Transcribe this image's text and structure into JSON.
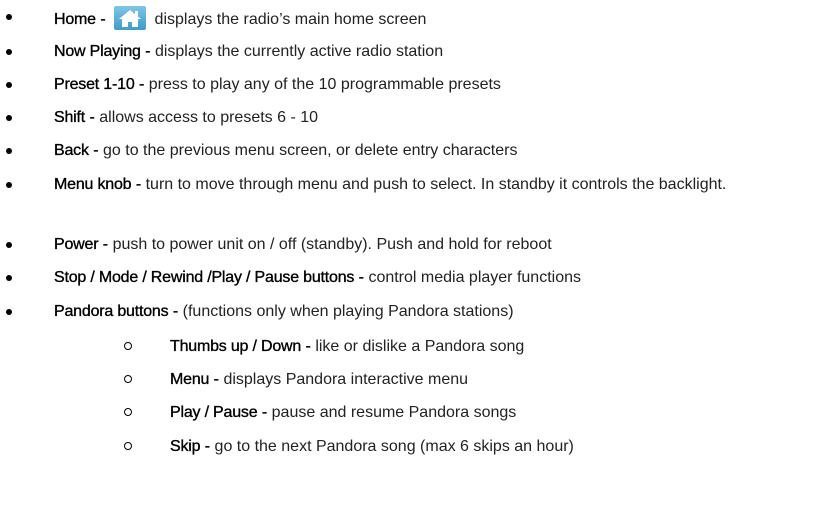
{
  "items": [
    {
      "term": "Home",
      "sep": " - ",
      "desc": " displays the radio’s main home screen",
      "icon": "home-icon"
    },
    {
      "term": "Now Playing",
      "sep": " - ",
      "desc": "displays the currently active radio station"
    },
    {
      "term": "Preset  1-10",
      "sep": " - ",
      "desc": "press to play any of the 10 programmable presets"
    },
    {
      "term": "Shift",
      "sep": "  - ",
      "desc": "allows access to presets 6 - 10"
    },
    {
      "term": "Back",
      "sep": "  - ",
      "desc": "go to the  previous menu screen, or delete entry characters"
    },
    {
      "term": "Menu knob",
      "sep": "  - ",
      "desc": "turn to move through menu and push to select. In standby it controls the backlight."
    },
    {
      "term": "Power",
      "sep": "  - ",
      "desc": "push to power unit on / off (standby). Push and hold for reboot"
    },
    {
      "term": "Stop / Mode / Rewind /Play / Pause buttons",
      "sep": "  - ",
      "desc": "control media player functions"
    },
    {
      "term": "Pandora buttons",
      "sep": "  - ",
      "desc": "(functions only when playing Pandora stations)"
    }
  ],
  "subitems": [
    {
      "term": "Thumbs up / Down",
      "sep": "  - ",
      "desc": "like or dislike a Pandora song"
    },
    {
      "term": "Menu",
      "sep": "  - ",
      "desc": "displays Pandora interactive menu"
    },
    {
      "term": "Play / Pause",
      "sep": "  - ",
      "desc": "pause and resume Pandora songs"
    },
    {
      "term": "Skip",
      "sep": "  - ",
      "desc": "go to the next Pandora song  (max 6 skips an hour)"
    }
  ]
}
